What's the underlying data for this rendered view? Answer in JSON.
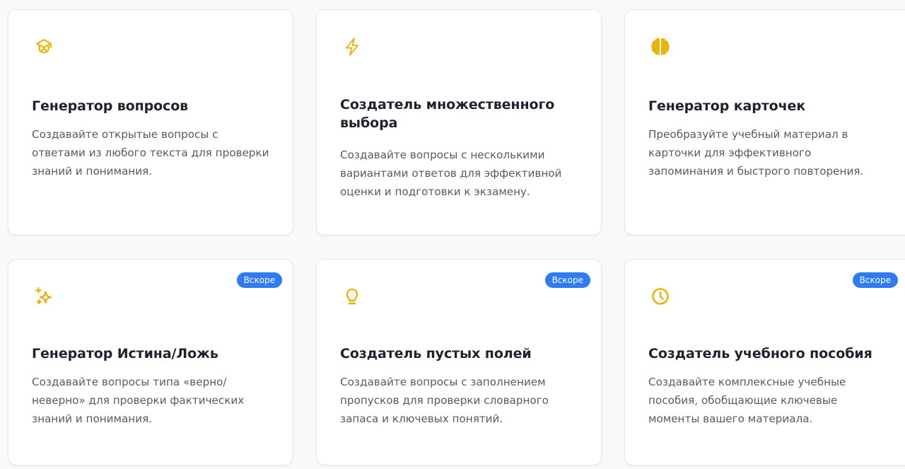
{
  "colors": {
    "accent_icon": "#eab308",
    "badge_bg": "#2f7cf2",
    "title_text": "#1f2330",
    "desc_text": "#545b68"
  },
  "cards": [
    {
      "icon": "graduation-cap-icon",
      "title": "Генератор вопросов",
      "description": "Создавайте открытые вопросы с ответами из любого текста для проверки знаний и понимания."
    },
    {
      "icon": "lightning-icon",
      "title": "Создатель множественного выбора",
      "description": "Создавайте вопросы с несколькими вариантами ответов для эффективной оценки и подготовки к экзамену."
    },
    {
      "icon": "brain-icon",
      "title": "Генератор карточек",
      "description": "Преобразуйте учебный материал в карточки для эффективного запоминания и быстрого повторения."
    },
    {
      "icon": "sparkles-icon",
      "badge": "Вскоре",
      "title": "Генератор Истина/Ложь",
      "description": "Создавайте вопросы типа «верно/неверно» для проверки фактических знаний и понимания."
    },
    {
      "icon": "lightbulb-icon",
      "badge": "Вскоре",
      "title": "Создатель пустых полей",
      "description": "Создавайте вопросы с заполнением пропусков для проверки словарного запаса и ключевых понятий."
    },
    {
      "icon": "clock-icon",
      "badge": "Вскоре",
      "title": "Создатель учебного пособия",
      "description": "Создавайте комплексные учебные пособия, обобщающие ключевые моменты вашего материала."
    }
  ]
}
